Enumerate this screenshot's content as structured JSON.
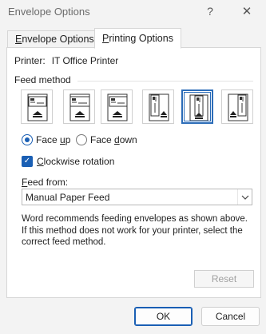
{
  "window": {
    "title": "Envelope Options",
    "help_glyph": "?",
    "close_glyph": "✕"
  },
  "tabs": [
    {
      "label": "Envelope Options",
      "mnemonic": "E",
      "rest": "nvelope Options",
      "active": false
    },
    {
      "label": "Printing Options",
      "mnemonic": "P",
      "rest": "rinting Options",
      "active": true
    }
  ],
  "printer": {
    "label": "Printer:",
    "value": "IT Office Printer"
  },
  "feed_method": {
    "label": "Feed method",
    "options": [
      {
        "name": "feed-method-1",
        "selected": false
      },
      {
        "name": "feed-method-2",
        "selected": false
      },
      {
        "name": "feed-method-3",
        "selected": false
      },
      {
        "name": "feed-method-4",
        "selected": false
      },
      {
        "name": "feed-method-5",
        "selected": true
      },
      {
        "name": "feed-method-6",
        "selected": false
      }
    ]
  },
  "face": {
    "up": {
      "prefix": "Face ",
      "mnemonic": "u",
      "rest": "p",
      "checked": true
    },
    "down": {
      "prefix": "Face ",
      "mnemonic": "d",
      "rest": "own",
      "checked": false
    }
  },
  "clockwise": {
    "mnemonic": "C",
    "rest": "lockwise rotation",
    "checked": true
  },
  "feed_from": {
    "label_mnemonic": "F",
    "label_rest": "eed from:",
    "value": "Manual Paper Feed"
  },
  "info_text": "Word recommends feeding envelopes as shown above. If this method does not work for your printer, select the correct feed method.",
  "buttons": {
    "reset": "Reset",
    "ok": "OK",
    "cancel": "Cancel"
  },
  "colors": {
    "accent": "#1a5fb4",
    "selected_border": "#2b6cb8"
  }
}
